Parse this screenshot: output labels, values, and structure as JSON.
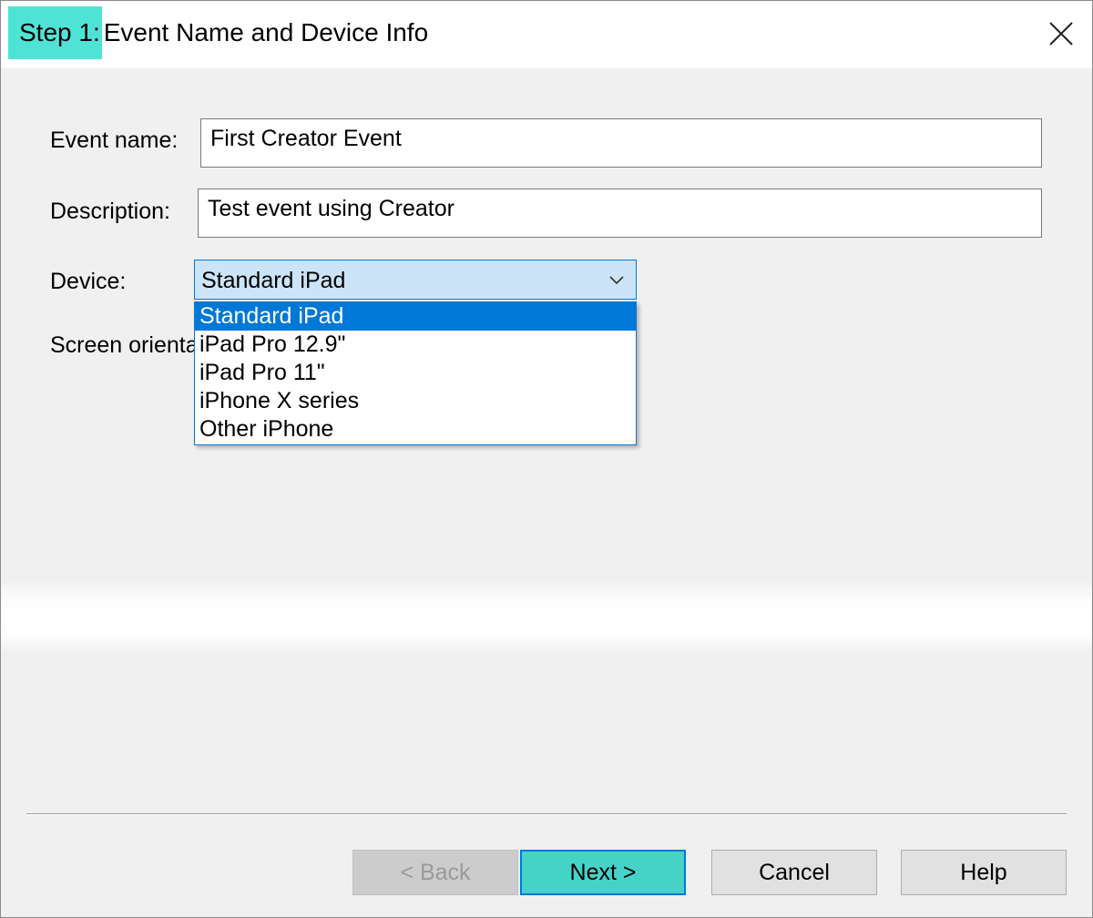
{
  "window": {
    "title_step": "Step 1:",
    "title_rest": " Event Name and Device Info"
  },
  "form": {
    "event_name_label": "Event name:",
    "event_name_value": "First Creator Event",
    "description_label": "Description:",
    "description_value": "Test event using Creator",
    "device_label": "Device:",
    "device_value": "Standard iPad",
    "orientation_label": "Screen orienta"
  },
  "device_options": [
    "Standard iPad",
    "iPad Pro 12.9\"",
    "iPad Pro 11\"",
    "iPhone X series",
    "Other iPhone"
  ],
  "buttons": {
    "back": "< Back",
    "next": "Next >",
    "cancel": "Cancel",
    "help": "Help"
  },
  "colors": {
    "title_highlight": "#4fe3d6",
    "selection": "#0078d7",
    "next_button": "#45d3c8"
  },
  "icons": {
    "close": "close-icon",
    "dropdown": "chevron-down-icon"
  }
}
